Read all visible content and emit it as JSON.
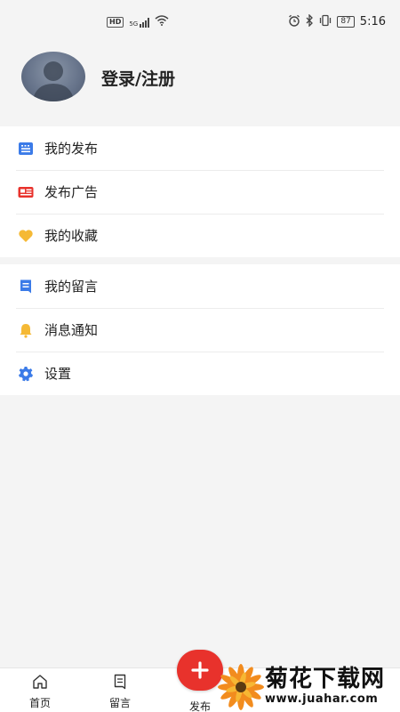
{
  "status_bar": {
    "left_badges": [
      "HD",
      "5G"
    ],
    "battery": "87",
    "time": "5:16"
  },
  "profile": {
    "login_label": "登录/注册"
  },
  "menu_group_1": [
    {
      "label": "我的发布",
      "icon": "document-list-icon",
      "color": "#3b7be8"
    },
    {
      "label": "发布广告",
      "icon": "ad-card-icon",
      "color": "#e8322c"
    },
    {
      "label": "我的收藏",
      "icon": "heart-icon",
      "color": "#f5b935"
    }
  ],
  "menu_group_2": [
    {
      "label": "我的留言",
      "icon": "message-bookmark-icon",
      "color": "#3b7be8"
    },
    {
      "label": "消息通知",
      "icon": "bell-icon",
      "color": "#f5b935"
    },
    {
      "label": "设置",
      "icon": "gear-icon",
      "color": "#3b7be8"
    }
  ],
  "tab_bar": {
    "home": "首页",
    "messages": "留言",
    "post": "发布"
  },
  "watermark": {
    "title": "菊花下载网",
    "url": "www.juahar.com"
  },
  "colors": {
    "accent_red": "#e8322c",
    "accent_blue": "#3b7be8",
    "accent_yellow": "#f5b935",
    "background": "#f4f4f4"
  }
}
